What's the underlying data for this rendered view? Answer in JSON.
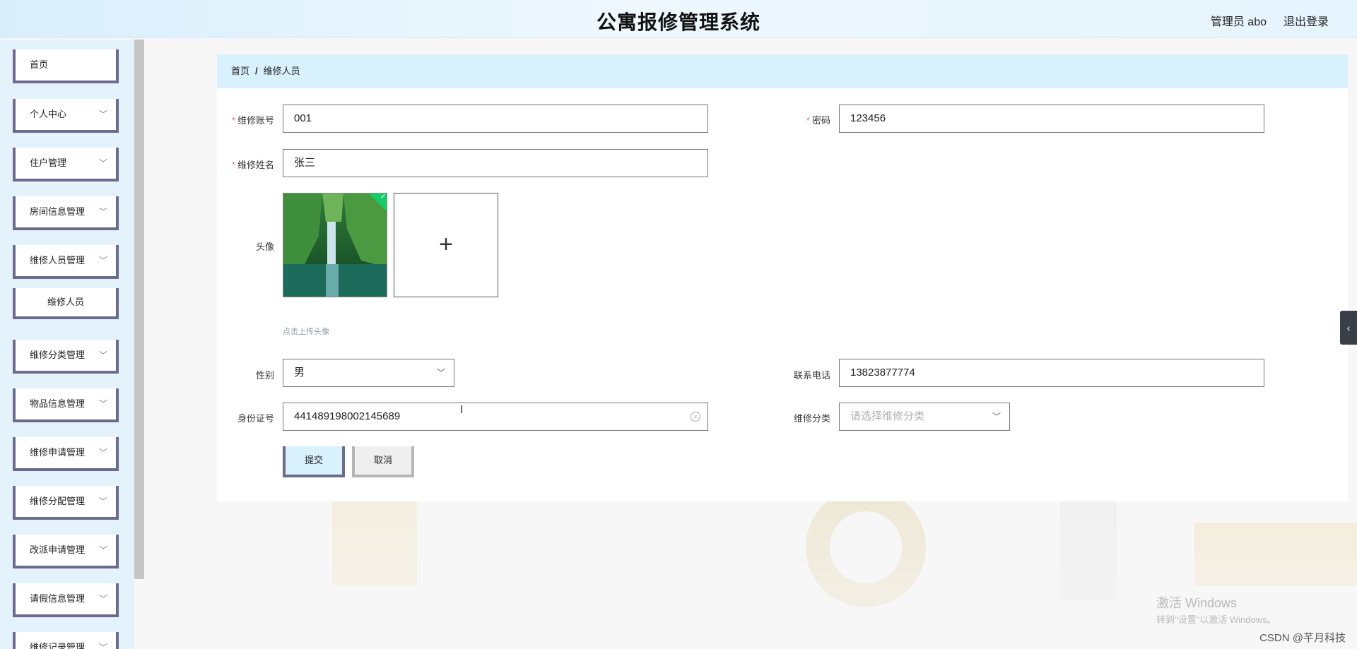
{
  "header": {
    "title": "公寓报修管理系统",
    "user": "管理员 abo",
    "logout": "退出登录"
  },
  "sidebar": {
    "items": [
      {
        "label": "首页",
        "chevron": false
      },
      {
        "label": "个人中心",
        "chevron": true
      },
      {
        "label": "住户管理",
        "chevron": true
      },
      {
        "label": "房间信息管理",
        "chevron": true
      },
      {
        "label": "维修人员管理",
        "chevron": true
      },
      {
        "label": "维修人员",
        "sub": true
      },
      {
        "label": "维修分类管理",
        "chevron": true
      },
      {
        "label": "物品信息管理",
        "chevron": true
      },
      {
        "label": "维修申请管理",
        "chevron": true
      },
      {
        "label": "维修分配管理",
        "chevron": true
      },
      {
        "label": "改派申请管理",
        "chevron": true
      },
      {
        "label": "请假信息管理",
        "chevron": true
      },
      {
        "label": "维修记录管理",
        "chevron": true
      }
    ]
  },
  "breadcrumb": {
    "home": "首页",
    "separator": "/",
    "current": "维修人员"
  },
  "form": {
    "account": {
      "label": "维修账号",
      "value": "001",
      "required": true
    },
    "password": {
      "label": "密码",
      "value": "123456",
      "required": true
    },
    "name": {
      "label": "维修姓名",
      "value": "张三",
      "required": true
    },
    "avatar": {
      "label": "头像",
      "hint": "点击上传头像",
      "upload_symbol": "+"
    },
    "gender": {
      "label": "性别",
      "value": "男"
    },
    "phone": {
      "label": "联系电话",
      "value": "13823877774"
    },
    "id_card": {
      "label": "身份证号",
      "value": "441489198002145689"
    },
    "category": {
      "label": "维修分类",
      "placeholder": "请选择维修分类"
    },
    "submit_label": "提交",
    "cancel_label": "取消",
    "required_mark": "*"
  },
  "icons": {
    "chevron": "chevron-down-icon",
    "collapse": "chevron-left-icon",
    "check": "check-icon",
    "clear": "clear-circle-icon"
  },
  "overlay": {
    "watermark_title": "激活 Windows",
    "watermark_sub": "转到\"设置\"以激活 Windows。",
    "csdn": "CSDN @芊月科技"
  },
  "colors": {
    "accent_bg": "#d9f0fd",
    "menu_border": "#6b6b8e",
    "required": "#f56c6c",
    "success": "#13ce66"
  }
}
